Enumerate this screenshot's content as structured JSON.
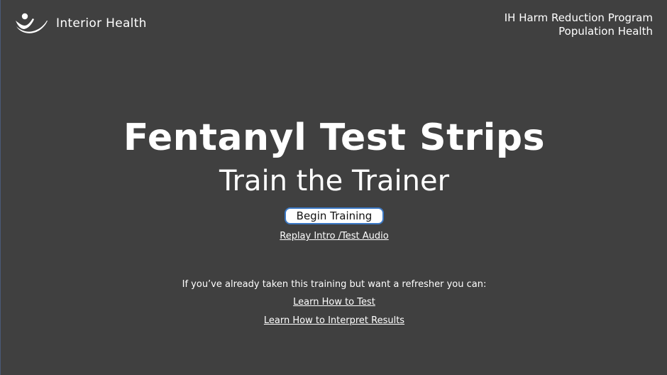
{
  "header": {
    "logo_text": "Interior Health",
    "org_line1": "IH Harm Reduction Program",
    "org_line2": "Population Health"
  },
  "main": {
    "title": "Fentanyl Test Strips",
    "subtitle": "Train the Trainer",
    "begin_button_label": "Begin Training",
    "replay_link": "Replay Intro /Test Audio",
    "refresher_text": "If you’ve already taken this training but want a refresher you can:",
    "learn_test_link": "Learn How to Test",
    "learn_interpret_link": "Learn How to Interpret Results"
  },
  "colors": {
    "background": "#404040",
    "text": "#ffffff",
    "button_border": "#3b78c4",
    "button_fill": "#ffffff"
  },
  "icons": {
    "logo": "interior-health-logo-icon"
  }
}
